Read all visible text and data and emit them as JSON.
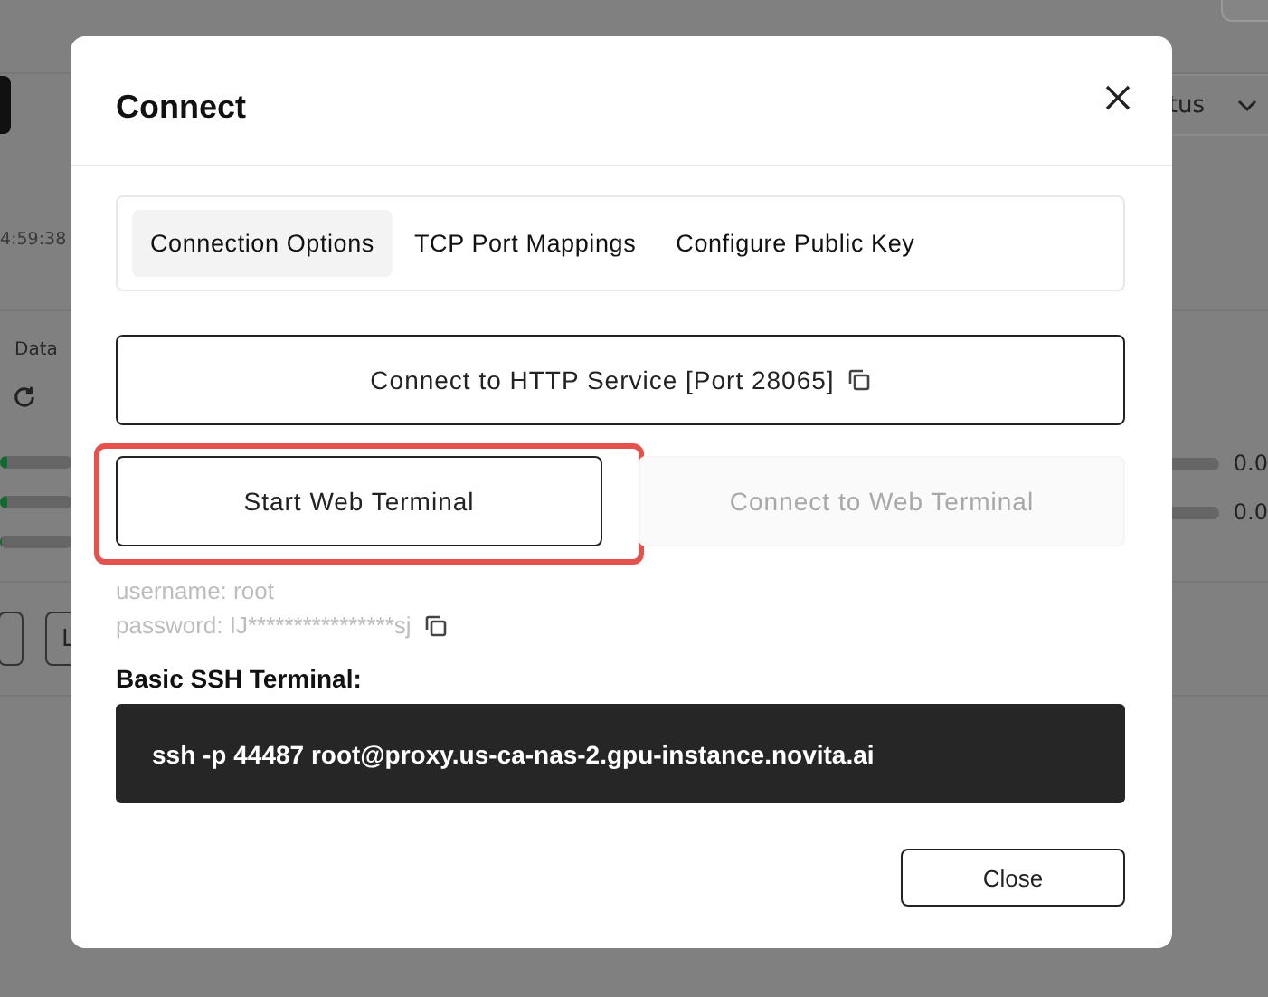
{
  "background": {
    "status_filter": "tus",
    "time": "4:59:38",
    "section_label": "Data",
    "meters": [
      {
        "level": 0.1
      },
      {
        "level": 0.1
      },
      {
        "level": 0.02
      }
    ],
    "readings": [
      "0.0",
      "0.0"
    ],
    "button_label": "L"
  },
  "dialog": {
    "title": "Connect",
    "tabs": [
      {
        "label": "Connection Options",
        "selected": true
      },
      {
        "label": "TCP Port Mappings",
        "selected": false
      },
      {
        "label": "Configure Public Key",
        "selected": false
      }
    ],
    "http_button": "Connect to HTTP Service [Port 28065]",
    "terminal_buttons": [
      {
        "label": "Start Web Terminal",
        "disabled": false,
        "highlighted": true
      },
      {
        "label": "Connect to Web Terminal",
        "disabled": true,
        "highlighted": false
      }
    ],
    "username": "username: root",
    "password": "password: IJ****************sj",
    "ssh_label": "Basic SSH Terminal:",
    "ssh_command": "ssh -p 44487 root@proxy.us-ca-nas-2.gpu-instance.novita.ai",
    "close_button": "Close"
  }
}
